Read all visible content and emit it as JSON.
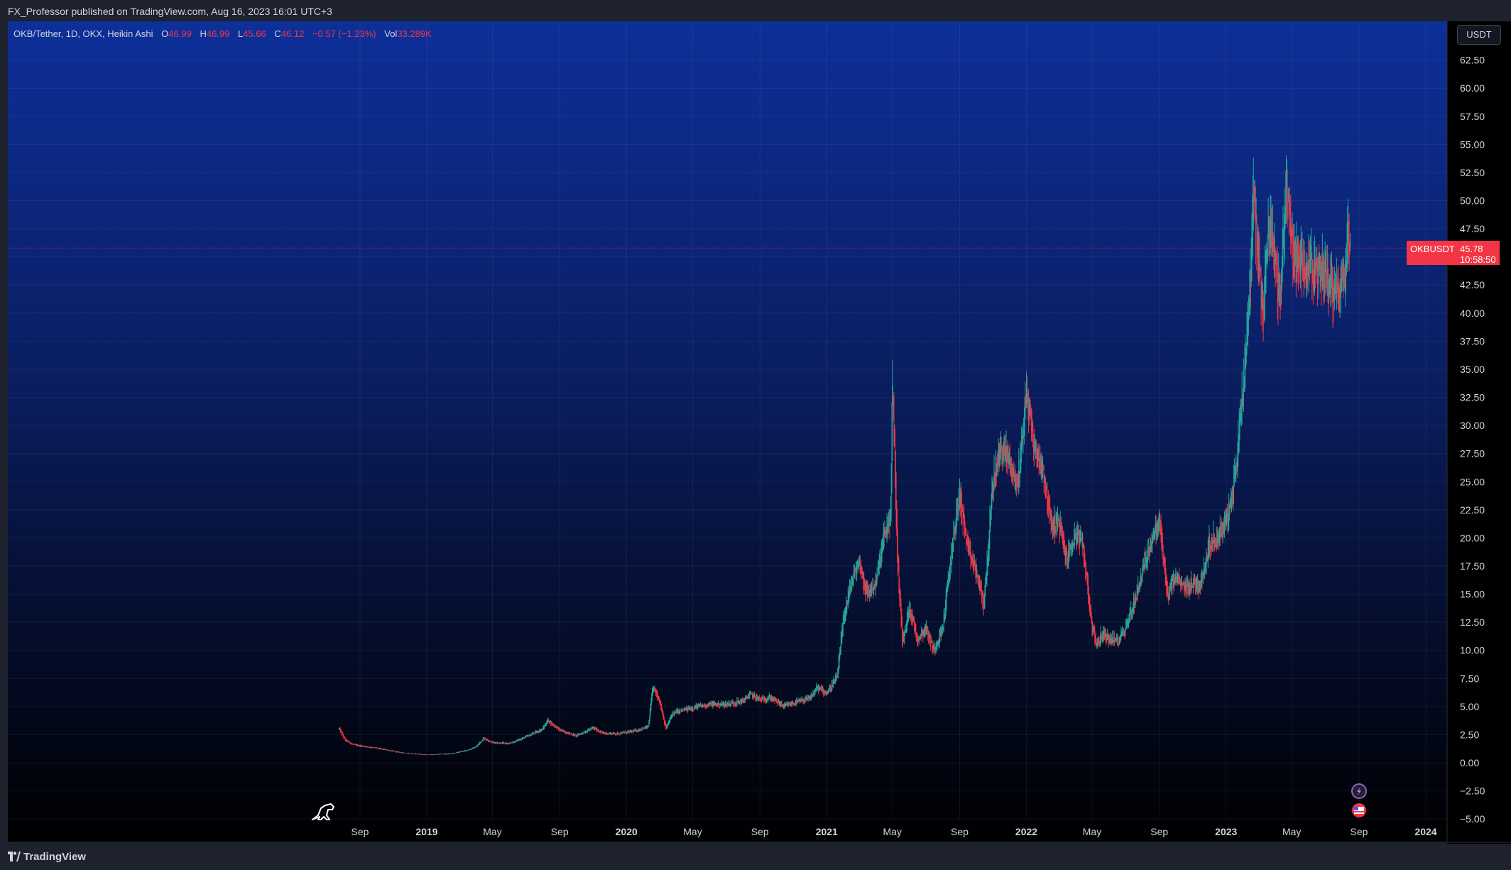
{
  "header": {
    "published": "FX_Professor published on TradingView.com, Aug 16, 2023 16:01 UTC+3"
  },
  "legend": {
    "symbol": "OKB/Tether, 1D, OKX, Heikin Ashi",
    "o_label": "O",
    "o_value": "46.99",
    "h_label": "H",
    "h_value": "46.99",
    "l_label": "L",
    "l_value": "45.66",
    "c_label": "C",
    "c_value": "46.12",
    "change": "−0.57 (−1.23%)",
    "vol_label": "Vol",
    "vol_value": "33.289K"
  },
  "currency_button": "USDT",
  "price_tag": {
    "symbol": "OKBUSDT",
    "price": "45.78",
    "countdown": "10:58:50"
  },
  "footer": {
    "brand": "TradingView"
  },
  "icons": [
    "dino-icon",
    "lightning-icon",
    "us-flag-icon",
    "tradingview-logo-icon"
  ],
  "colors": {
    "up": "#26a69a",
    "down": "#f23645",
    "bg_top": "#0d2f99",
    "bg_bottom": "#000000",
    "frame": "#1e222d"
  },
  "chart_data": {
    "type": "candlestick",
    "style": "Heikin Ashi",
    "interval": "1D",
    "x_tick_labels": [
      "Sep",
      "2019",
      "May",
      "Sep",
      "2020",
      "May",
      "Sep",
      "2021",
      "May",
      "Sep",
      "2022",
      "May",
      "Sep",
      "2023",
      "May",
      "Sep",
      "2024"
    ],
    "y_tick_labels": [
      "62.50",
      "60.00",
      "57.50",
      "55.00",
      "52.50",
      "50.00",
      "47.50",
      "45.00",
      "42.50",
      "40.00",
      "37.50",
      "35.00",
      "32.50",
      "30.00",
      "27.50",
      "25.00",
      "22.50",
      "20.00",
      "17.50",
      "15.00",
      "12.50",
      "10.00",
      "7.50",
      "5.00",
      "2.50",
      "0.00",
      "−2.50",
      "−5.00"
    ],
    "ylim": [
      -5,
      65
    ],
    "grid": true,
    "last_price": 45.78,
    "close_series": {
      "x": [
        "2018-07-25",
        "2018-08-05",
        "2018-08-20",
        "2018-10-01",
        "2018-11-15",
        "2019-01-01",
        "2019-02-15",
        "2019-03-15",
        "2019-04-01",
        "2019-04-15",
        "2019-05-01",
        "2019-06-01",
        "2019-07-01",
        "2019-08-01",
        "2019-08-10",
        "2019-09-01",
        "2019-10-01",
        "2019-11-01",
        "2019-11-20",
        "2019-12-15",
        "2020-01-15",
        "2020-02-10",
        "2020-02-18",
        "2020-03-01",
        "2020-03-13",
        "2020-03-25",
        "2020-05-01",
        "2020-06-01",
        "2020-07-01",
        "2020-08-01",
        "2020-08-15",
        "2020-09-01",
        "2020-09-20",
        "2020-10-15",
        "2020-11-01",
        "2020-12-01",
        "2020-12-15",
        "2021-01-01",
        "2021-01-20",
        "2021-02-01",
        "2021-02-15",
        "2021-03-01",
        "2021-03-15",
        "2021-04-01",
        "2021-04-15",
        "2021-04-28",
        "2021-05-01",
        "2021-05-10",
        "2021-05-20",
        "2021-06-01",
        "2021-06-15",
        "2021-07-01",
        "2021-07-15",
        "2021-08-01",
        "2021-08-20",
        "2021-09-01",
        "2021-09-15",
        "2021-10-01",
        "2021-10-15",
        "2021-11-01",
        "2021-11-15",
        "2021-12-01",
        "2021-12-15",
        "2022-01-01",
        "2022-01-15",
        "2022-02-01",
        "2022-02-15",
        "2022-03-01",
        "2022-03-15",
        "2022-04-01",
        "2022-04-15",
        "2022-05-01",
        "2022-05-10",
        "2022-05-20",
        "2022-06-01",
        "2022-06-15",
        "2022-07-01",
        "2022-07-15",
        "2022-08-01",
        "2022-08-15",
        "2022-09-01",
        "2022-09-15",
        "2022-10-01",
        "2022-10-15",
        "2022-11-01",
        "2022-11-15",
        "2022-12-01",
        "2022-12-15",
        "2023-01-01",
        "2023-01-10",
        "2023-01-20",
        "2023-02-01",
        "2023-02-10",
        "2023-02-15",
        "2023-02-20",
        "2023-03-01",
        "2023-03-10",
        "2023-03-15",
        "2023-03-25",
        "2023-04-01",
        "2023-04-10",
        "2023-04-20",
        "2023-05-01",
        "2023-05-15",
        "2023-06-01",
        "2023-06-15",
        "2023-07-01",
        "2023-07-15",
        "2023-08-01",
        "2023-08-06",
        "2023-08-10",
        "2023-08-16"
      ],
      "y": [
        3.0,
        2.0,
        1.6,
        1.3,
        0.9,
        0.7,
        0.8,
        1.1,
        1.4,
        2.2,
        1.8,
        1.7,
        2.3,
        3.0,
        3.8,
        2.9,
        2.4,
        3.1,
        2.6,
        2.6,
        2.8,
        3.2,
        6.8,
        5.6,
        3.0,
        4.4,
        4.9,
        5.2,
        5.2,
        5.5,
        6.1,
        5.6,
        5.8,
        5.0,
        5.3,
        5.7,
        6.7,
        6.2,
        7.6,
        13.0,
        16.0,
        18.0,
        15.0,
        16.0,
        20.0,
        22.0,
        35.0,
        18.0,
        10.5,
        14.0,
        11.0,
        12.0,
        10.0,
        12.0,
        20.0,
        24.0,
        19.0,
        17.0,
        14.0,
        25.0,
        28.0,
        27.0,
        24.5,
        33.0,
        28.0,
        26.0,
        21.0,
        21.5,
        18.0,
        20.5,
        19.0,
        12.0,
        10.5,
        11.5,
        11.0,
        10.8,
        12.0,
        14.0,
        17.0,
        19.5,
        21.5,
        15.0,
        16.5,
        15.5,
        16.0,
        15.8,
        19.5,
        20.0,
        21.5,
        23.0,
        27.0,
        34.0,
        40.0,
        44.0,
        52.0,
        44.0,
        40.0,
        46.0,
        48.0,
        44.0,
        41.0,
        52.0,
        46.0,
        44.0,
        45.0,
        43.0,
        44.0,
        42.0,
        43.0,
        43.5,
        48.5,
        45.78
      ]
    }
  }
}
